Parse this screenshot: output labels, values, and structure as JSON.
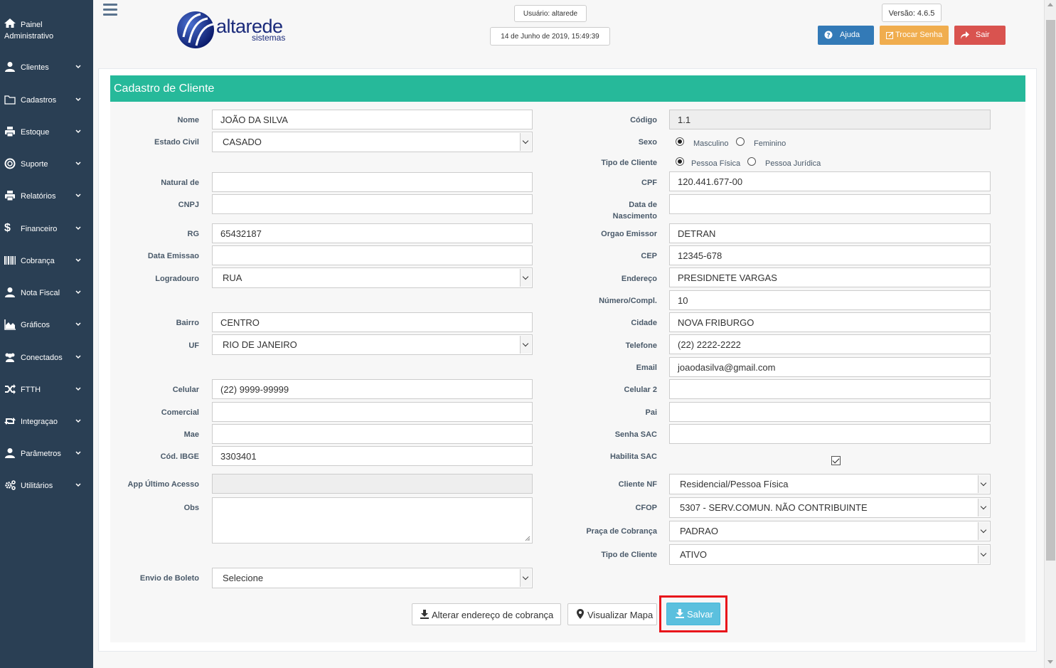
{
  "sidebar": {
    "header_line1": "Painel",
    "header_line2": "Administrativo",
    "items": [
      {
        "label": "Clientes",
        "icon": "user-icon"
      },
      {
        "label": "Cadastros",
        "icon": "folder-icon"
      },
      {
        "label": "Estoque",
        "icon": "printer-icon"
      },
      {
        "label": "Suporte",
        "icon": "lifebuoy-icon"
      },
      {
        "label": "Relatórios",
        "icon": "printer-icon"
      },
      {
        "label": "Financeiro",
        "icon": "dollar-icon"
      },
      {
        "label": "Cobrança",
        "icon": "barcode-icon"
      },
      {
        "label": "Nota Fiscal",
        "icon": "user-icon"
      },
      {
        "label": "Gráficos",
        "icon": "area-chart-icon"
      },
      {
        "label": "Conectados",
        "icon": "users-icon"
      },
      {
        "label": "FTTH",
        "icon": "random-icon"
      },
      {
        "label": "Integraçao",
        "icon": "retweet-icon"
      },
      {
        "label": "Parâmetros",
        "icon": "user-icon"
      },
      {
        "label": "Utilitários",
        "icon": "cogs-icon"
      }
    ]
  },
  "header": {
    "logo_text": "altarede",
    "logo_subtext": "sistemas",
    "user": "Usuário: altarede",
    "datetime": "14 de Junho de 2019, 15:49:39",
    "version": "Versão: 4.6.5",
    "help_label": "Ajuda",
    "change_password_label": "Trocar Senha",
    "exit_label": "Sair",
    "colors": {
      "help": "#337ab7",
      "change_password": "#f0ad4e",
      "exit": "#d9534f"
    }
  },
  "form": {
    "title": "Cadastro de Cliente",
    "title_color": "#26b99a",
    "left": {
      "nome": {
        "label": "Nome",
        "value": "JOÃO DA SILVA"
      },
      "estado_civil": {
        "label": "Estado Civil",
        "value": "CASADO"
      },
      "natural_de": {
        "label": "Natural de",
        "value": ""
      },
      "cnpj": {
        "label": "CNPJ",
        "value": ""
      },
      "rg": {
        "label": "RG",
        "value": "65432187"
      },
      "data_emissao": {
        "label": "Data Emissao",
        "value": ""
      },
      "logradouro": {
        "label": "Logradouro",
        "value": "RUA"
      },
      "bairro": {
        "label": "Bairro",
        "value": "CENTRO"
      },
      "uf": {
        "label": "UF",
        "value": "RIO DE JANEIRO"
      },
      "celular": {
        "label": "Celular",
        "value": "(22) 9999-99999"
      },
      "comercial": {
        "label": "Comercial",
        "value": ""
      },
      "mae": {
        "label": "Mae",
        "value": ""
      },
      "cod_ibge": {
        "label": "Cód. IBGE",
        "value": "3303401"
      },
      "app_ultimo_acesso": {
        "label": "App Último Acesso",
        "value": ""
      },
      "obs": {
        "label": "Obs",
        "value": ""
      },
      "envio_boleto": {
        "label": "Envio de Boleto",
        "value": "Selecione"
      }
    },
    "right": {
      "codigo": {
        "label": "Código",
        "value": "1.1"
      },
      "sexo": {
        "label": "Sexo",
        "options": [
          "Masculino",
          "Feminino"
        ],
        "selected": "Masculino"
      },
      "tipo_cliente_radio": {
        "label": "Tipo de Cliente",
        "options": [
          "Pessoa Física",
          "Pessoa Jurídica"
        ],
        "selected": "Pessoa Física"
      },
      "cpf": {
        "label": "CPF",
        "value": "120.441.677-00"
      },
      "data_nascimento": {
        "label_line1": "Data de",
        "label_line2": "Nascimento",
        "value": ""
      },
      "orgao_emissor": {
        "label": "Orgao Emissor",
        "value": "DETRAN"
      },
      "cep": {
        "label": "CEP",
        "value": "12345-678"
      },
      "endereco": {
        "label": "Endereço",
        "value": "PRESIDNETE VARGAS"
      },
      "numero": {
        "label": "Número/Compl.",
        "value": "10"
      },
      "cidade": {
        "label": "Cidade",
        "value": "NOVA FRIBURGO"
      },
      "telefone": {
        "label": "Telefone",
        "value": "(22) 2222-2222"
      },
      "email": {
        "label": "Email",
        "value": "joaodasilva@gmail.com"
      },
      "celular2": {
        "label": "Celular 2",
        "value": ""
      },
      "pai": {
        "label": "Pai",
        "value": ""
      },
      "senha_sac": {
        "label": "Senha SAC",
        "value": ""
      },
      "habilita_sac": {
        "label": "Habilita SAC",
        "checked": true
      },
      "cliente_nf": {
        "label": "Cliente NF",
        "value": "Residencial/Pessoa Física"
      },
      "cfop": {
        "label": "CFOP",
        "value": "5307 - SERV.COMUN. NÃO CONTRIBUINTE"
      },
      "praca_cobranca": {
        "label": "Praça de Cobrança",
        "value": "PADRAO"
      },
      "tipo_cliente_select": {
        "label": "Tipo de Cliente",
        "value": "ATIVO"
      }
    },
    "buttons": {
      "alterar_endereco": "Alterar endereço de cobrança",
      "visualizar_mapa": "Visualizar Mapa",
      "salvar": "Salvar"
    }
  }
}
